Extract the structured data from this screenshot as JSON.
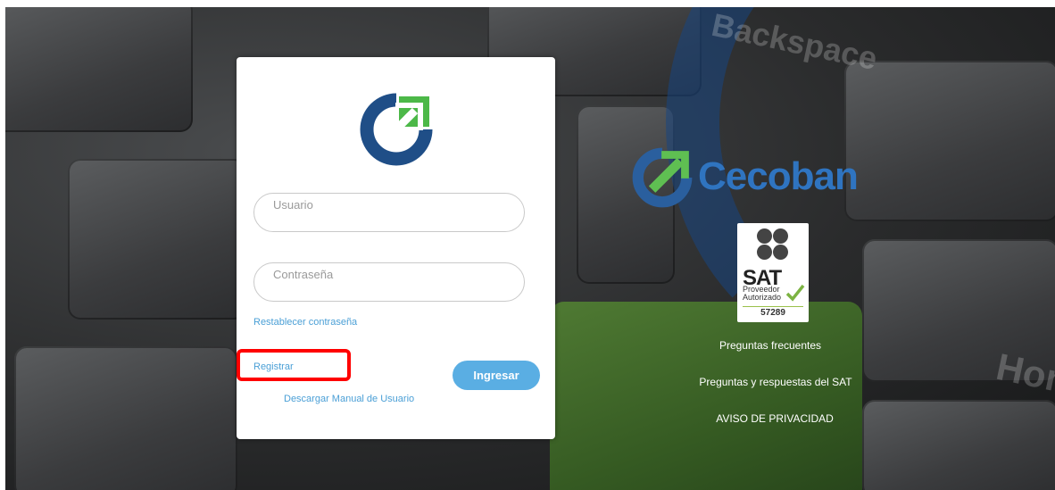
{
  "login": {
    "username_placeholder": "Usuario",
    "password_placeholder": "Contraseña",
    "reset_password": "Restablecer contraseña",
    "register": "Registrar",
    "login_button": "Ingresar",
    "download_manual": "Descargar Manual de Usuario"
  },
  "brand": {
    "name": "Cecoban"
  },
  "sat_badge": {
    "title": "SAT",
    "line1": "Proveedor",
    "line2": "Autorizado",
    "number": "57289"
  },
  "links": {
    "faq": "Preguntas frecuentes",
    "sat_faq": "Preguntas y respuestas del SAT",
    "privacy": "AVISO DE PRIVACIDAD"
  },
  "background_text": {
    "backspace": "Backspace",
    "home": "Hom"
  },
  "colors": {
    "accent": "#5aaee3",
    "brand_blue": "#2f74c0",
    "brand_green": "#4caf50",
    "highlight": "#ff0000"
  }
}
